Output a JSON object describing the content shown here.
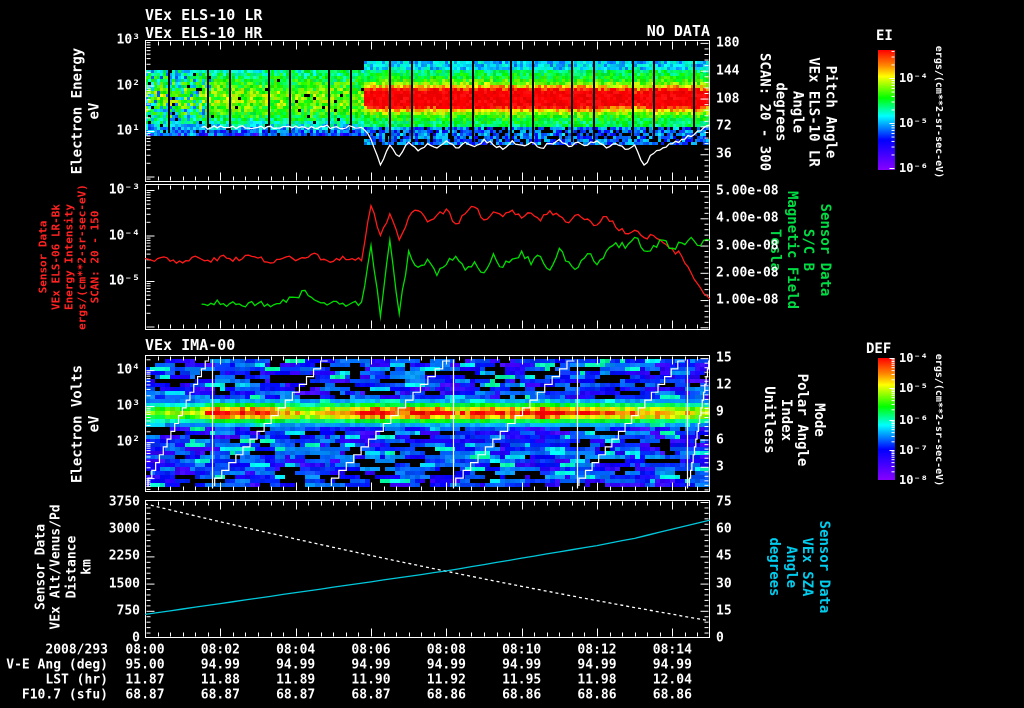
{
  "colors": {
    "background": "#000000",
    "foreground": "#ffffff",
    "red_series": "#ff1a1a",
    "green_series": "#00dd00",
    "cyan_series": "#00c8dc",
    "label_red": "#ff2222",
    "label_green": "#00dd44",
    "label_cyan": "#00ccee"
  },
  "header": {
    "title_line1": "VEx ELS-10 LR",
    "title_line2": "VEx ELS-10 HR",
    "no_data": "NO DATA"
  },
  "time_axis": {
    "date_label": "2008/293",
    "tick_labels": [
      "08:00",
      "08:02",
      "08:04",
      "08:06",
      "08:08",
      "08:10",
      "08:12",
      "08:14"
    ],
    "start_minute": 0,
    "end_minute": 15,
    "major_step_min": 2
  },
  "bottom_rows": [
    {
      "label": "V-E Ang (deg)",
      "values": [
        "95.00",
        "94.99",
        "94.99",
        "94.99",
        "94.99",
        "94.99",
        "94.99",
        "94.99"
      ]
    },
    {
      "label": "LST (hr)",
      "values": [
        "11.87",
        "11.88",
        "11.89",
        "11.90",
        "11.92",
        "11.95",
        "11.98",
        "12.04"
      ]
    },
    {
      "label": "F10.7 (sfu)",
      "values": [
        "68.87",
        "68.87",
        "68.87",
        "68.87",
        "68.86",
        "68.86",
        "68.86",
        "68.86"
      ]
    }
  ],
  "colorbars": [
    {
      "id": "els",
      "title": "EI",
      "unit": "ergs/(cm**2-sr-sec-eV)",
      "tick_labels": [
        "10⁻⁴",
        "10⁻⁵",
        "10⁻⁶"
      ],
      "tick_fracs": [
        0.233,
        0.608,
        0.983
      ]
    },
    {
      "id": "ima",
      "title": "DEF",
      "unit": "ergs/(cm**2-sr-sec-eV)",
      "tick_labels": [
        "10⁻⁴",
        "10⁻⁵",
        "10⁻⁶",
        "10⁻⁷",
        "10⁻⁸"
      ],
      "tick_fracs": [
        0.0,
        0.246,
        0.508,
        0.754,
        1.0
      ]
    }
  ],
  "chart_data": [
    {
      "type": "heatmap",
      "name": "els_energy_time_spectrogram",
      "title": "",
      "left_axis": {
        "label_lines": [
          "Electron Energy",
          "eV"
        ],
        "scale": "log",
        "tick_labels": [
          "10³",
          "10²",
          "10¹"
        ],
        "tick_values": [
          1000,
          100,
          10
        ]
      },
      "right_axis": {
        "label_lines": [
          "Pitch Angle",
          "VEx ELS-10 LR",
          "Angle",
          "degrees",
          "SCAN: 20 - 300"
        ],
        "scale": "linear",
        "tick_labels": [
          "180",
          "144",
          "108",
          "72",
          "36"
        ],
        "tick_values": [
          180,
          144,
          108,
          72,
          36
        ]
      },
      "colorbar": "EI",
      "description": "Green 10-300 eV flux before 08:06; intense red band near 100 eV from 08:06 to end; blue speckle below; black sweep-segment gaps; white count-rate trace overlay",
      "features": {
        "intense_band_profile": [
          [
            5.7,
            0
          ],
          [
            5.8,
            0.6
          ],
          [
            6.0,
            1
          ],
          [
            11.9,
            1
          ],
          [
            12.1,
            0.8
          ],
          [
            12.6,
            0.9
          ],
          [
            13.0,
            0.7
          ],
          [
            13.3,
            0.85
          ],
          [
            13.5,
            1
          ],
          [
            14.6,
            1
          ],
          [
            14.8,
            0.7
          ],
          [
            15.0,
            0.5
          ]
        ],
        "segment_divider_minutes": [
          0.61,
          1.65,
          2.22,
          3.26,
          3.83,
          4.87,
          5.44,
          6.48,
          7.06,
          8.09,
          8.67,
          9.7,
          10.28,
          11.31,
          11.89,
          12.93,
          13.5,
          14.54
        ]
      },
      "white_trace": {
        "note": "uncalibrated overlay trace, fraction of panel height from top",
        "step_min": 0.25,
        "y_fracs": [
          null,
          null,
          null,
          null,
          null,
          null,
          0.615,
          0.62,
          0.605,
          0.615,
          0.61,
          0.62,
          0.615,
          0.61,
          0.62,
          0.61,
          0.605,
          0.615,
          0.62,
          0.61,
          0.615,
          0.625,
          0.61,
          0.615,
          0.7,
          0.88,
          0.74,
          0.82,
          0.72,
          0.78,
          0.73,
          0.76,
          0.71,
          0.76,
          0.72,
          0.75,
          0.7,
          0.74,
          0.77,
          0.71,
          0.74,
          0.72,
          0.76,
          0.73,
          0.7,
          0.75,
          0.72,
          0.74,
          0.71,
          0.76,
          0.73,
          0.77,
          0.74,
          0.88,
          0.8,
          0.76,
          0.73,
          0.7,
          0.68,
          0.64,
          0.6
        ]
      }
    },
    {
      "type": "line",
      "name": "els_intensity_and_magnetic_field",
      "left_axis": {
        "label_lines": [
          "Sensor Data",
          "VEx ELS-06 LR-Bk",
          "Energy Intensity",
          "ergs/(cm**2-sr-sec-eV)",
          "SCAN: 20 - 150"
        ],
        "scale": "log",
        "tick_labels": [
          "10⁻³",
          "10⁻⁴",
          "10⁻⁵"
        ],
        "tick_values": [
          0.001,
          0.0001,
          1e-05
        ]
      },
      "right_axis": {
        "label_lines": [
          "Sensor Data",
          "S/C B",
          "Magnetic Field",
          "Tesla"
        ],
        "scale": "linear",
        "tick_labels": [
          "5.00e-08",
          "4.00e-08",
          "3.00e-08",
          "2.00e-08",
          "1.00e-08"
        ],
        "tick_values": [
          5e-08,
          4e-08,
          3e-08,
          2e-08,
          1e-08
        ]
      },
      "step_min": 0.25,
      "series": [
        {
          "name": "energy_intensity",
          "axis": "left",
          "color": "#ff1a1a",
          "values": [
            3.1e-05,
            2.7e-05,
            3.4e-05,
            2.9e-05,
            2.5e-05,
            3.3e-05,
            3e-05,
            2.6e-05,
            3.5e-05,
            3.1e-05,
            2.8e-05,
            3.7e-05,
            3.2e-05,
            2.6e-05,
            3e-05,
            3.4e-05,
            2.8e-05,
            3.2e-05,
            4.1e-05,
            3e-05,
            2.7e-05,
            3.5e-05,
            3.1e-05,
            2.8e-05,
            0.00045,
            0.0001,
            0.0003,
            8e-05,
            0.00025,
            0.00035,
            0.0002,
            0.00028,
            0.00038,
            0.00018,
            0.0003,
            0.00042,
            0.00022,
            0.00033,
            0.00026,
            0.00036,
            0.00024,
            0.00031,
            0.00021,
            0.00035,
            0.00027,
            0.00019,
            0.00029,
            0.00023,
            0.00017,
            0.00026,
            0.00015,
            0.00011,
            0.00013,
            9e-05,
            0.0001,
            7e-05,
            5e-05,
            3.5e-05,
            1.5e-05,
            7e-06,
            4e-06
          ]
        },
        {
          "name": "magnetic_field",
          "axis": "right",
          "color": "#00dd00",
          "values": [
            null,
            null,
            null,
            null,
            null,
            null,
            8.5e-09,
            8.8e-09,
            8.4e-09,
            8.7e-09,
            8.6e-09,
            9e-09,
            8.8e-09,
            8.5e-09,
            8.7e-09,
            9.2e-09,
            1.1e-08,
            1.35e-08,
            1e-08,
            9e-09,
            9.5e-09,
            8.8e-09,
            9e-09,
            9.3e-09,
            3e-08,
            4e-09,
            3.2e-08,
            5e-09,
            2.8e-08,
            2.2e-08,
            2.5e-08,
            1.9e-08,
            2.3e-08,
            2.6e-08,
            2.1e-08,
            2.4e-08,
            2e-08,
            2.7e-08,
            2.2e-08,
            2.5e-08,
            2.8e-08,
            2.3e-08,
            2.6e-08,
            2.1e-08,
            2.9e-08,
            2.4e-08,
            2.2e-08,
            2.7e-08,
            2.3e-08,
            2.8e-08,
            3.1e-08,
            2.9e-08,
            3.3e-08,
            2.8e-08,
            3e-08,
            3.2e-08,
            2.9e-08,
            3.1e-08,
            3.3e-08,
            3e-08,
            3.2e-08
          ]
        }
      ]
    },
    {
      "type": "heatmap",
      "name": "ima_ion_spectrogram",
      "title": "VEx IMA-00",
      "left_axis": {
        "label_lines": [
          "Electron Volts",
          "eV"
        ],
        "scale": "log",
        "tick_labels": [
          "10⁴",
          "10³",
          "10²"
        ],
        "tick_values": [
          10000,
          1000,
          100
        ]
      },
      "right_axis": {
        "label_lines": [
          "Mode",
          "Polar Angle",
          "Index",
          "Unitless"
        ],
        "scale": "linear",
        "tick_labels": [
          "15",
          "12",
          "9",
          "6",
          "3"
        ],
        "tick_values": [
          15,
          12,
          9,
          6,
          3
        ]
      },
      "colorbar": "DEF",
      "description": "Blue streaky background with bright green-yellow-red band near 600 eV; white elevation staircase scan lines and vertical scan dividers",
      "features": {
        "band_center_ev": 600,
        "band_profile": [
          [
            0,
            0.5
          ],
          [
            1.4,
            0.6
          ],
          [
            1.8,
            0.95
          ],
          [
            3.3,
            0.85
          ],
          [
            4.2,
            0.65
          ],
          [
            5.3,
            0.8
          ],
          [
            6.0,
            0.95
          ],
          [
            6.8,
            0.85
          ],
          [
            7.5,
            0.95
          ],
          [
            8.3,
            0.8
          ],
          [
            9.0,
            0.9
          ],
          [
            9.8,
            0.85
          ],
          [
            10.5,
            0.95
          ],
          [
            11.3,
            0.8
          ],
          [
            12.0,
            0.85
          ],
          [
            12.8,
            0.75
          ],
          [
            13.5,
            0.8
          ],
          [
            14.2,
            0.7
          ],
          [
            15.0,
            0.6
          ]
        ],
        "scan_divider_minutes": [
          1.78,
          8.18,
          11.47,
          14.39
        ],
        "elevation_staircases": [
          {
            "start_min": 0.08,
            "end_min": 1.7
          },
          {
            "start_min": 1.85,
            "end_min": 4.85
          },
          {
            "start_min": 4.95,
            "end_min": 8.1
          },
          {
            "start_min": 8.25,
            "end_min": 11.4
          },
          {
            "start_min": 11.52,
            "end_min": 14.32
          },
          {
            "start_min": 14.45,
            "end_min": 15.0
          }
        ]
      }
    },
    {
      "type": "line",
      "name": "altitude_and_solar_zenith_angle",
      "left_axis": {
        "label_lines": [
          "Sensor Data",
          "VEx Alt/Venus/Pd",
          "Distance",
          "km"
        ],
        "scale": "linear",
        "tick_labels": [
          "3750",
          "3000",
          "2250",
          "1500",
          "750",
          "0"
        ],
        "tick_values": [
          3750,
          3000,
          2250,
          1500,
          750,
          0
        ]
      },
      "right_axis": {
        "label_lines": [
          "Sensor Data",
          "VEx SZA",
          "Angle",
          "degrees"
        ],
        "scale": "linear",
        "tick_labels": [
          "75",
          "60",
          "45",
          "30",
          "15",
          "0"
        ],
        "tick_values": [
          75,
          60,
          45,
          30,
          15,
          0
        ]
      },
      "step_min": 1,
      "series": [
        {
          "name": "altitude_km",
          "axis": "left",
          "color": "#ffffff",
          "dashed": true,
          "values": [
            3700,
            3450,
            3205,
            2965,
            2730,
            2500,
            2275,
            2055,
            1840,
            1630,
            1425,
            1225,
            1030,
            840,
            655,
            470
          ]
        },
        {
          "name": "sza_deg",
          "axis": "right",
          "color": "#00c8dc",
          "values": [
            13,
            16,
            19,
            22,
            25,
            28,
            31,
            34,
            37,
            40.5,
            44,
            47.5,
            51,
            55,
            60,
            65
          ]
        }
      ]
    }
  ]
}
